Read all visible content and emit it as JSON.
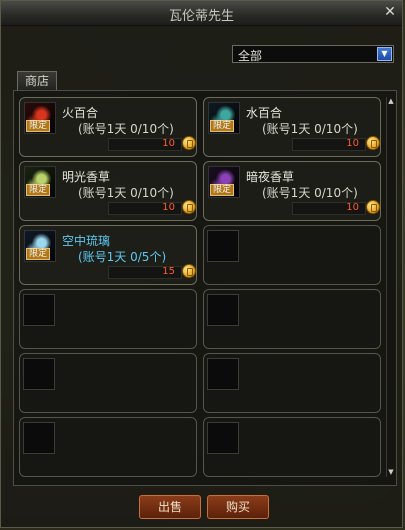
{
  "window": {
    "title": "瓦伦蒂先生"
  },
  "filter": {
    "selected": "全部"
  },
  "tabs": [
    {
      "label": "商店"
    }
  ],
  "items": [
    {
      "name": "火百合",
      "limit": "(账号1天 0/10个)",
      "limited_badge": "限定",
      "price": "10",
      "name_color": "#e6e6dc",
      "icon": "fire-lily-icon",
      "icon_colors": [
        "#2b0a08",
        "#d8341e"
      ]
    },
    {
      "name": "水百合",
      "limit": "(账号1天 0/10个)",
      "limited_badge": "限定",
      "price": "10",
      "name_color": "#e6e6dc",
      "icon": "water-lily-icon",
      "icon_colors": [
        "#0c1a22",
        "#3fa6a0"
      ]
    },
    {
      "name": "明光香草",
      "limit": "(账号1天 0/10个)",
      "limited_badge": "限定",
      "price": "10",
      "name_color": "#e6e6dc",
      "icon": "bright-herb-icon",
      "icon_colors": [
        "#1a2410",
        "#b9d36a"
      ]
    },
    {
      "name": "暗夜香草",
      "limit": "(账号1天 0/10个)",
      "limited_badge": "限定",
      "price": "10",
      "name_color": "#e6e6dc",
      "icon": "night-herb-icon",
      "icon_colors": [
        "#1a0d22",
        "#8b42b6"
      ]
    },
    {
      "name": "空中琉璃",
      "limit": "(账号1天 0/5个)",
      "limited_badge": "限定",
      "price": "15",
      "name_color": "#5ec8f0",
      "icon": "sky-glass-icon",
      "icon_colors": [
        "#0e1a2a",
        "#9ad8f0"
      ]
    }
  ],
  "buttons": {
    "sell": "出售",
    "buy": "购买"
  }
}
